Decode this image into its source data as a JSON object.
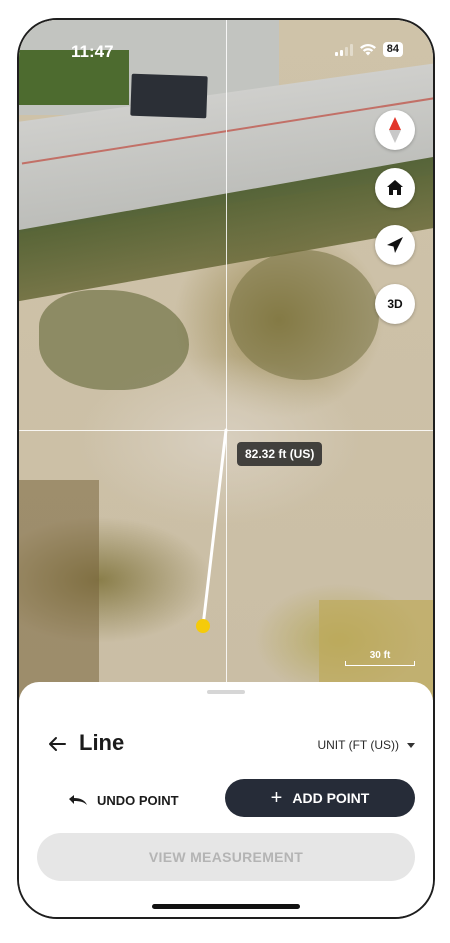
{
  "status_bar": {
    "time": "11:47",
    "battery": "84"
  },
  "map": {
    "measurement_label": "82.32 ft (US)",
    "scale_label": "30 ft",
    "controls": [
      "compass-icon",
      "home-icon",
      "locate-icon",
      "3D"
    ]
  },
  "map_controls": {
    "btn_3d_label": "3D"
  },
  "sheet": {
    "title": "Line",
    "unit_label": "UNIT (FT (US))",
    "undo_label": "UNDO POINT",
    "add_label": "ADD POINT",
    "view_label": "VIEW MEASUREMENT"
  },
  "colors": {
    "point": "#f5cb0a",
    "primary_button": "#262c38",
    "disabled_button": "#e6e6e6",
    "compass_red": "#e2362b"
  }
}
